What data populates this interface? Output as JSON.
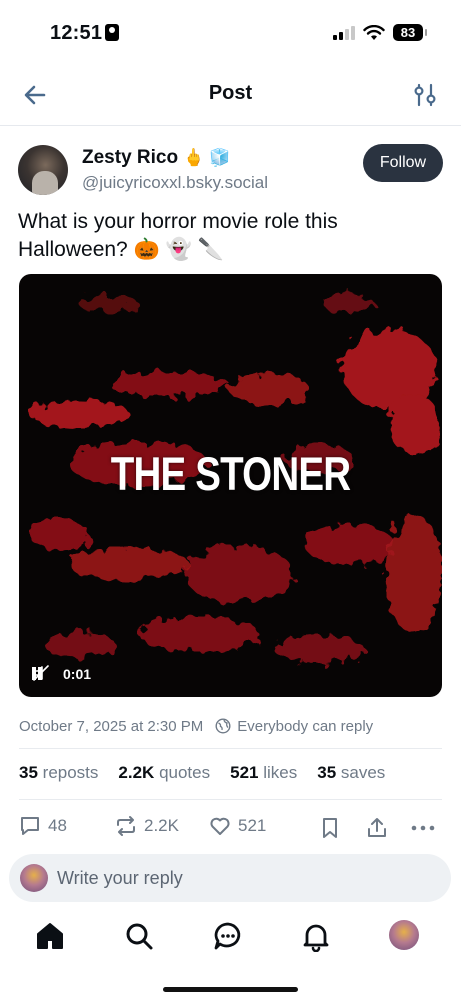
{
  "status_bar": {
    "time": "12:51",
    "battery": "83",
    "icons": [
      "id-card-icon",
      "signal-icon",
      "wifi-icon",
      "battery-icon"
    ]
  },
  "header": {
    "title": "Post",
    "back_icon": "arrow-left-icon",
    "filter_icon": "sliders-icon"
  },
  "author": {
    "name": "Zesty Rico",
    "badges": "🖕 🧊",
    "handle": "@juicyricoxxl.bsky.social",
    "follow_label": "Follow"
  },
  "post": {
    "text": "What is your horror movie role this Halloween? 🎃 👻 🔪"
  },
  "media": {
    "title": "THE STONER",
    "elapsed": "0:01",
    "pause_icon": "pause-icon",
    "mute_icon": "mute-icon"
  },
  "meta": {
    "timestamp": "October 7, 2025 at 2:30 PM",
    "reply_setting": "Everybody can reply"
  },
  "stats": {
    "reposts_count": "35",
    "reposts_label": "reposts",
    "quotes_count": "2.2K",
    "quotes_label": "quotes",
    "likes_count": "521",
    "likes_label": "likes",
    "saves_count": "35",
    "saves_label": "saves"
  },
  "actions": {
    "replies": "48",
    "reposts": "2.2K",
    "likes": "521"
  },
  "reply_box": {
    "placeholder": "Write your reply"
  },
  "colors": {
    "accent": "#2a3340",
    "muted": "#6f7a87",
    "blood": "#b3121a"
  }
}
